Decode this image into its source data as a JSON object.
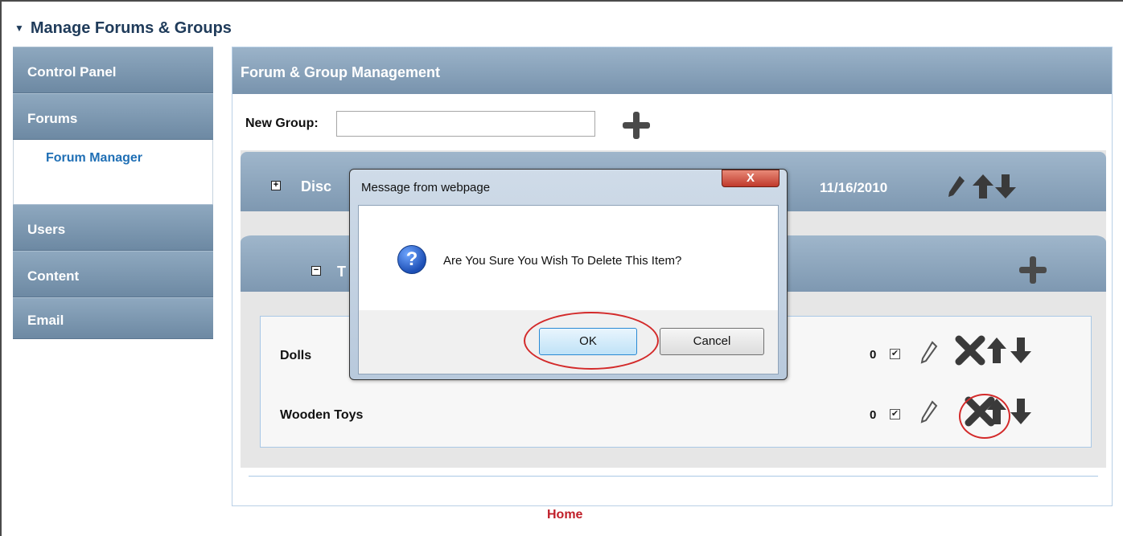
{
  "page": {
    "title": "Manage Forums & Groups",
    "collapse_glyph": "▼"
  },
  "sidebar": {
    "items": [
      {
        "label": "Control Panel"
      },
      {
        "label": "Forums"
      },
      {
        "label": "Users"
      },
      {
        "label": "Content"
      },
      {
        "label": "Email"
      }
    ],
    "sub_items": [
      {
        "label": "Forum Manager"
      }
    ]
  },
  "panel": {
    "title": "Forum & Group Management",
    "new_group": {
      "label": "New Group:",
      "value": "",
      "placeholder": ""
    },
    "group": {
      "name_visible": "Disc",
      "date": "11/16/2010",
      "expander": "+"
    },
    "subgroup": {
      "name_visible": "T",
      "expander": "−"
    },
    "items": [
      {
        "name": "Dolls",
        "count": "0",
        "checked": "✔"
      },
      {
        "name": "Wooden Toys",
        "count": "0",
        "checked": "✔"
      }
    ]
  },
  "dialog": {
    "title": "Message from webpage",
    "close_glyph": "X",
    "icon_glyph": "?",
    "message": "Are You Sure You Wish To Delete This Item?",
    "ok_label": "OK",
    "cancel_label": "Cancel"
  },
  "footer": {
    "home_link": "Home"
  },
  "colors": {
    "accent_blue": "#7e98b1",
    "highlight_red": "#d32a2a",
    "link_blue": "#1f6fb5",
    "home_red": "#c0202a"
  },
  "icons": [
    "add-icon",
    "edit-pencil-icon",
    "delete-x-icon",
    "move-up-arrow-icon",
    "move-down-arrow-icon",
    "question-icon",
    "close-icon"
  ]
}
